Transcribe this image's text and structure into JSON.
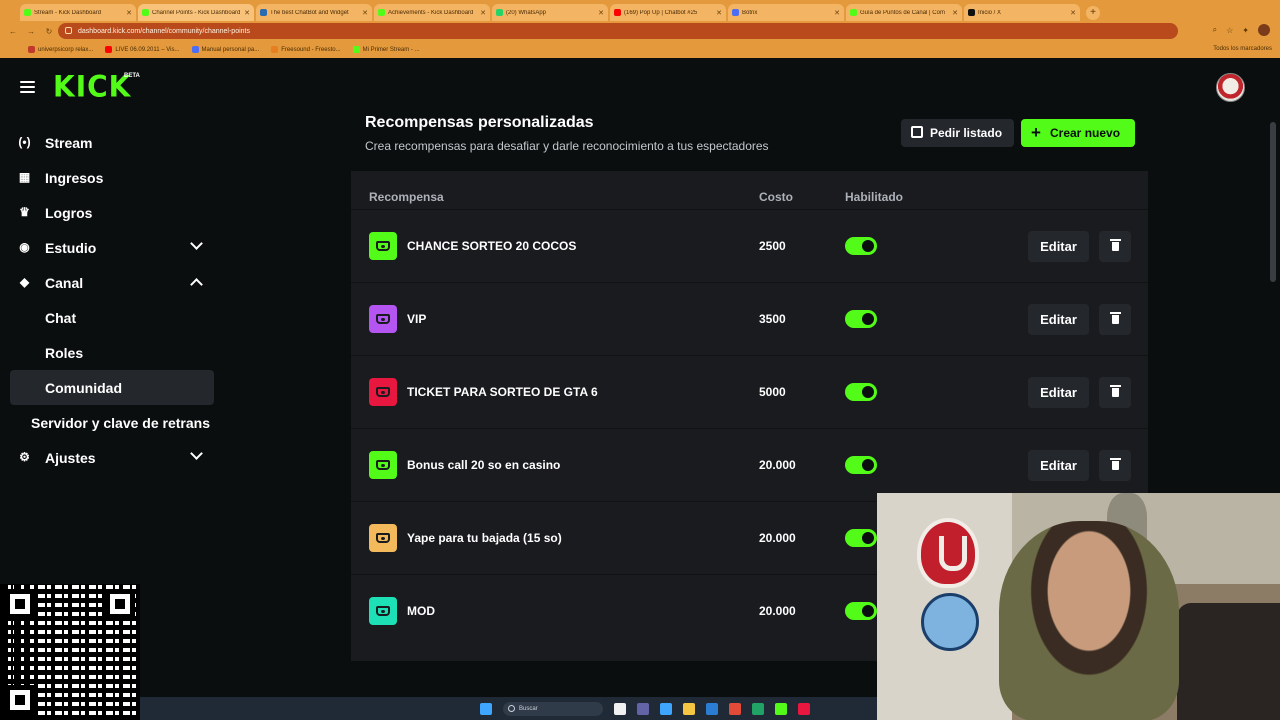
{
  "browser": {
    "tabs": [
      {
        "label": "Stream - Kick Dashboard",
        "fav": "#53fc18",
        "active": false
      },
      {
        "label": "Channel Points - Kick Dashboard",
        "fav": "#53fc18",
        "active": true
      },
      {
        "label": "The best ChatBot and Widget",
        "fav": "#2b6cb0",
        "active": false
      },
      {
        "label": "Achievements - Kick Dashboard",
        "fav": "#53fc18",
        "active": false
      },
      {
        "label": "(20) WhatsApp",
        "fav": "#25d366",
        "active": false
      },
      {
        "label": "(169) Pop Up | Chatbot #25",
        "fav": "#ff0000",
        "active": false
      },
      {
        "label": "Botrix",
        "fav": "#4c6ef5",
        "active": false
      },
      {
        "label": "Guía de Puntos de Canal | Com",
        "fav": "#53fc18",
        "active": false
      },
      {
        "label": "Inicio / X",
        "fav": "#111111",
        "active": false
      }
    ],
    "new_tab": "+",
    "url": "dashboard.kick.com/channel/community/channel-points",
    "bookmarks": [
      {
        "label": "univerpsicorp relax...",
        "color": "#c0392b"
      },
      {
        "label": "LIVE 06.09.2011 – Vis...",
        "color": "#ff0000"
      },
      {
        "label": "Manual personal pa...",
        "color": "#4c6ef5"
      },
      {
        "label": "Freesound - Freesto...",
        "color": "#e67e22"
      },
      {
        "label": "Mi Primer Stream - ...",
        "color": "#53fc18"
      }
    ],
    "bookmarks_right": "Todos los marcadores"
  },
  "app": {
    "logo": "KICK",
    "beta": "BETA"
  },
  "sidebar": {
    "items": [
      {
        "label": "Stream",
        "icon": "(•)",
        "name": "sidebar-item-stream"
      },
      {
        "label": "Ingresos",
        "icon": "▦",
        "name": "sidebar-item-ingresos"
      },
      {
        "label": "Logros",
        "icon": "♛",
        "name": "sidebar-item-logros"
      },
      {
        "label": "Estudio",
        "icon": "◉",
        "name": "sidebar-item-estudio"
      },
      {
        "label": "Canal",
        "icon": "◆",
        "name": "sidebar-item-canal"
      },
      {
        "label": "Chat",
        "name": "sidebar-item-chat"
      },
      {
        "label": "Roles",
        "name": "sidebar-item-roles"
      },
      {
        "label": "Comunidad",
        "name": "sidebar-item-comunidad"
      },
      {
        "label": "Servidor y clave de retrans",
        "name": "sidebar-item-servidor"
      },
      {
        "label": "Ajustes",
        "icon": "⚙",
        "name": "sidebar-item-ajustes"
      }
    ]
  },
  "main": {
    "title": "Recompensas personalizadas",
    "subtitle": "Crea recompensas para desafiar y darle reconocimiento a tus espectadores",
    "request_list_label": "Pedir listado",
    "create_new_label": "Crear nuevo",
    "columns": {
      "reward": "Recompensa",
      "cost": "Costo",
      "enabled": "Habilitado"
    },
    "edit_label": "Editar",
    "rewards": [
      {
        "name": "CHANCE SORTEO 20 COCOS",
        "cost": "2500",
        "color": "#53fc18",
        "enabled": true
      },
      {
        "name": "VIP",
        "cost": "3500",
        "color": "#b455f2",
        "enabled": true
      },
      {
        "name": "TICKET PARA SORTEO DE GTA 6",
        "cost": "5000",
        "color": "#e8173f",
        "enabled": true
      },
      {
        "name": "Bonus call 20 so en casino",
        "cost": "20.000",
        "color": "#53fc18",
        "enabled": true
      },
      {
        "name": "Yape para tu bajada (15 so)",
        "cost": "20.000",
        "color": "#f4b95a",
        "enabled": true
      },
      {
        "name": "MOD",
        "cost": "20.000",
        "color": "#1ee0b6",
        "enabled": true
      }
    ]
  },
  "taskbar": {
    "search_placeholder": "Buscar"
  }
}
